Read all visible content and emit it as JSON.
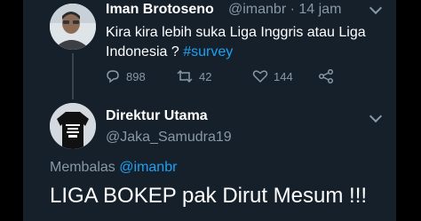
{
  "tweet": {
    "author_name": "Iman Brotoseno",
    "author_handle": "@imanbr",
    "time": "14 jam",
    "text": "Kira kira lebih suka Liga Inggris atau Liga Indonesia ?",
    "hashtag": "#survey",
    "reply_count": "898",
    "retweet_count": "42",
    "like_count": "144",
    "icons": [
      "reply-icon",
      "retweet-icon",
      "like-icon",
      "share-icon",
      "chevron-down-icon"
    ]
  },
  "reply": {
    "author_name": "Direktur Utama",
    "author_handle": "@Jaka_Samudra19",
    "replying_label": "Membalas",
    "replying_to": "@imanbr",
    "text": "LIGA BOKEP pak Dirut Mesum !!!"
  },
  "colors": {
    "background": "#15202b",
    "accent": "#1da1f2",
    "secondary_text": "#8899a6"
  }
}
